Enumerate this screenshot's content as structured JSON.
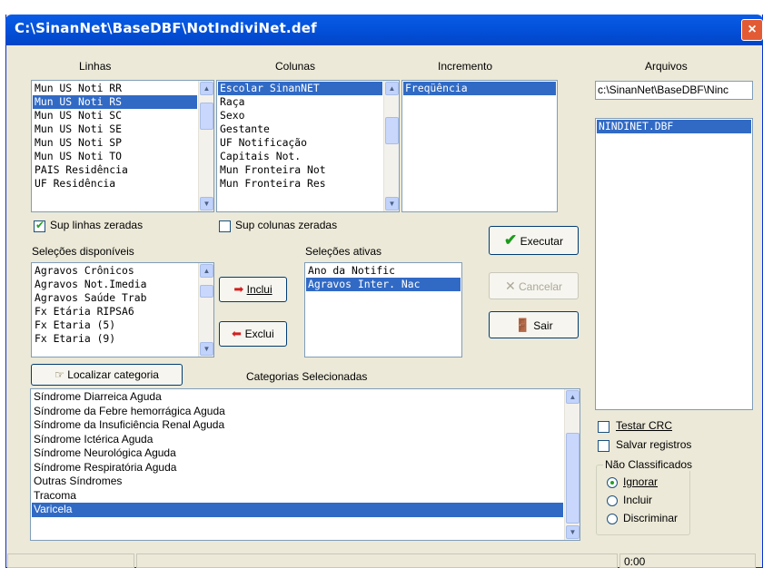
{
  "window": {
    "title": "C:\\SinanNet\\BaseDBF\\NotIndiviNet.def",
    "close": "×"
  },
  "headers": {
    "linhas": "Linhas",
    "colunas": "Colunas",
    "incremento": "Incremento",
    "arquivos": "Arquivos"
  },
  "linhas": {
    "items": [
      "Mun US Noti RR",
      "Mun US Noti RS",
      "Mun US Noti SC",
      "Mun US Noti SE",
      "Mun US Noti SP",
      "Mun US Noti TO",
      "PAIS Residência",
      "UF Residência"
    ],
    "selected": 1
  },
  "colunas": {
    "items": [
      "Escolar SinanNET",
      "Raça",
      "Sexo",
      "Gestante",
      "UF Notificação",
      "Capitais Not.",
      "Mun Fronteira Not",
      "Mun Fronteira Res"
    ],
    "selected": 0
  },
  "incremento": {
    "items": [
      "Freqüência"
    ],
    "selected": 0
  },
  "arquivos": {
    "path": "c:\\SinanNet\\BaseDBF\\Ninc",
    "items": [
      "NINDINET.DBF"
    ],
    "selected": 0
  },
  "checks": {
    "sup_linhas": "Sup linhas zeradas",
    "sup_colunas": "Sup colunas zeradas",
    "testar_crc": "Testar CRC",
    "salvar_registros": "Salvar registros"
  },
  "selecoes_disponiveis": {
    "label": "Seleções disponíveis",
    "items": [
      "Agravos Crônicos",
      "Agravos Not.Imedia",
      "Agravos Saúde Trab",
      "Fx Etária RIPSA6",
      "Fx Etaria (5)",
      "Fx Etaria (9)"
    ]
  },
  "selecoes_ativas": {
    "label": "Seleções ativas",
    "items": [
      "Ano da Notific",
      "Agravos Inter. Nac"
    ],
    "selected": 1
  },
  "buttons": {
    "executar": "Executar",
    "cancelar": "Cancelar",
    "sair": "Sair",
    "inclui": "Inclui",
    "exclui": "Exclui",
    "localizar": "Localizar categoria"
  },
  "categorias": {
    "label": "Categorias Selecionadas",
    "items": [
      "Síndrome Diarreica Aguda",
      "Síndrome da Febre hemorrágica Aguda",
      "Síndrome da Insuficiência Renal Aguda",
      "Síndrome Ictérica Aguda",
      "Síndrome Neurológica Aguda",
      "Síndrome Respiratória Aguda",
      "Outras Síndromes",
      "Tracoma",
      "Varicela"
    ],
    "selected": 8
  },
  "nao_classificados": {
    "label": "Não Classificados",
    "options": [
      "Ignorar",
      "Incluir",
      "Discriminar"
    ],
    "selected": 0
  },
  "status": {
    "time": "0:00"
  },
  "colors": {
    "selection": "#316ac5",
    "titlebar": "#0453dc"
  }
}
